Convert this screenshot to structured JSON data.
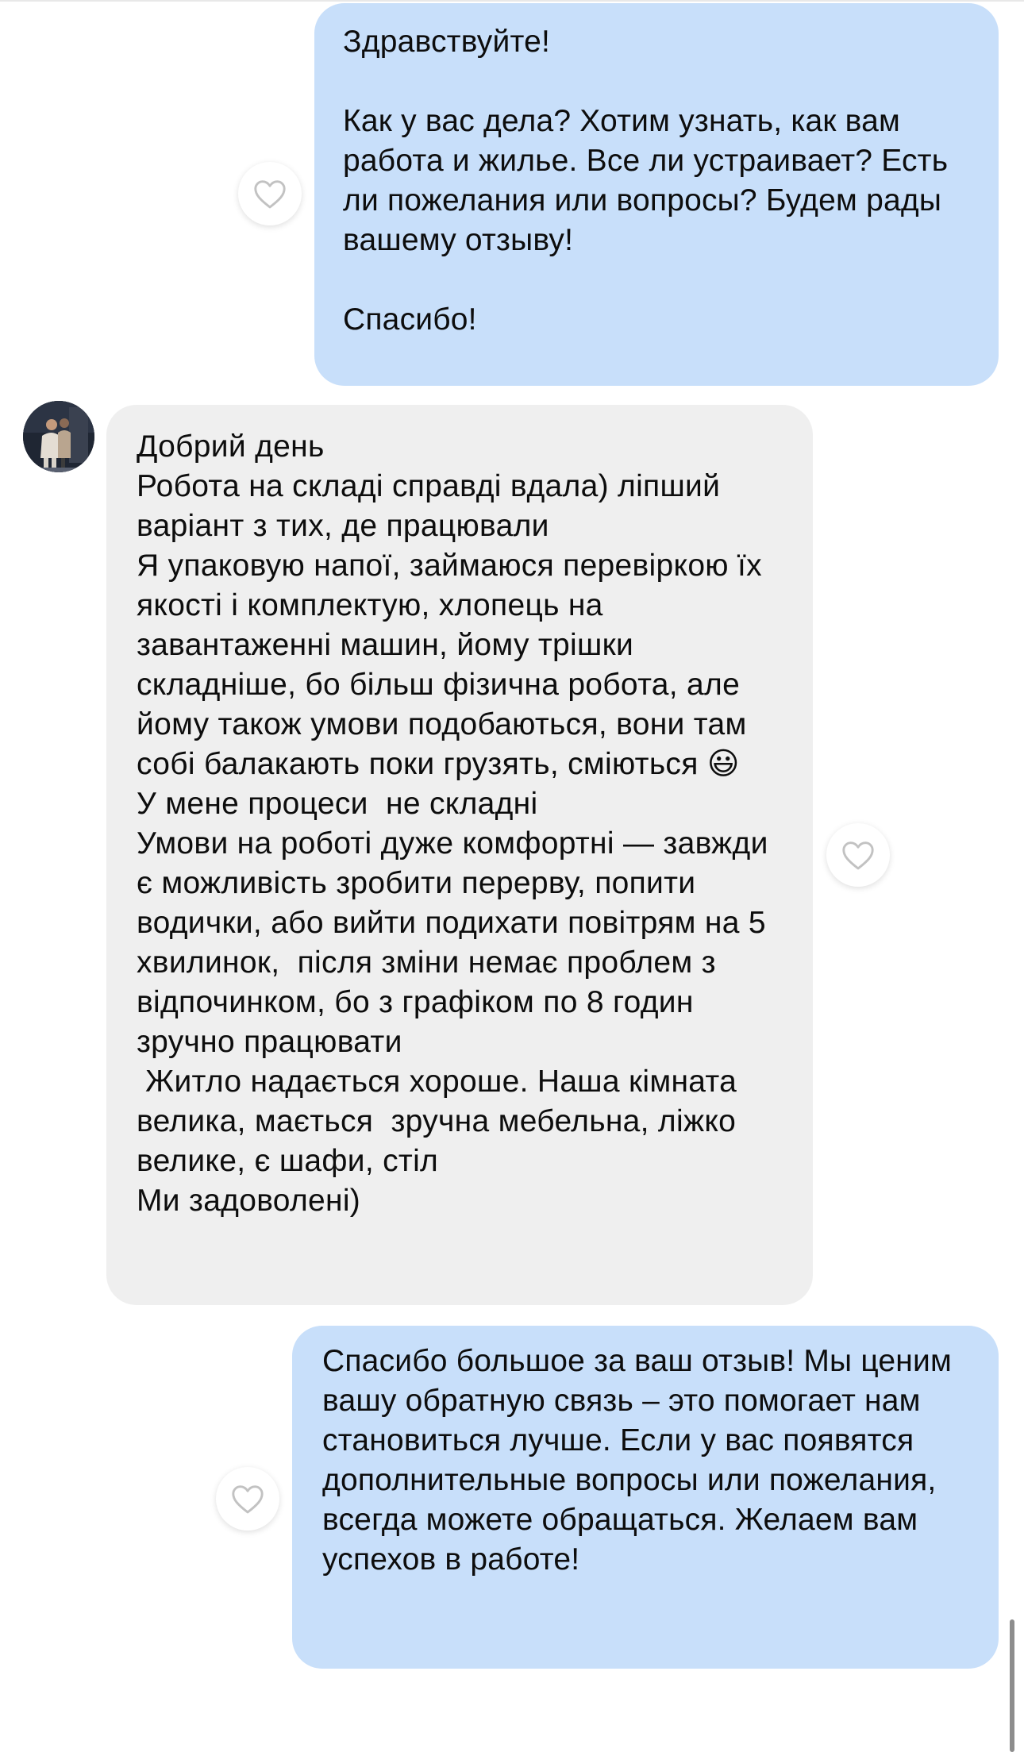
{
  "chat": {
    "messages": [
      {
        "direction": "outgoing",
        "text": "Здравствуйте!\n\nКак у вас дела? Хотим узнать, как вам работа и жилье. Все ли устраивает? Есть ли пожелания или вопросы? Будем рады вашему отзыву!\n\nСпасибо!"
      },
      {
        "direction": "incoming",
        "text": "Добрий день\nРобота на складі справді вдала) ліпший варіант з тих, де працювали\nЯ упаковую напої, займаюся перевіркою їх якості і комплектую, хлопець на завантаженні машин, йому трішки складніше, бо більш фізична робота, але йому також умови подобаються, вони там собі балакають поки грузять, сміються 😃\nУ мене процеси  не складні\nУмови на роботі дуже комфортні — завжди є можливість зробити перерву, попити водички, або вийти подихати повітрям на 5 хвилинок,  після зміни немає проблем з відпочинком, бо з графіком по 8 годин зручно працювати\n Житло надається хороше. Наша кімната велика, мається  зручна мебельна, ліжко велике, є шафи, стіл\nМи задоволені)"
      },
      {
        "direction": "outgoing",
        "text": "Спасибо большое за ваш отзыв! Мы ценим вашу обратную связь – это помогает нам становиться лучше. Если у вас появятся дополнительные вопросы или пожелания, всегда можете обращаться. Желаем вам успехов в работе!"
      }
    ]
  },
  "icons": {
    "like": "heart-outline-icon",
    "avatar": "user-avatar-photo"
  },
  "colors": {
    "outgoing_bubble": "#c8dffa",
    "incoming_bubble": "#efefef",
    "heart_stroke": "#c2c2c2"
  }
}
